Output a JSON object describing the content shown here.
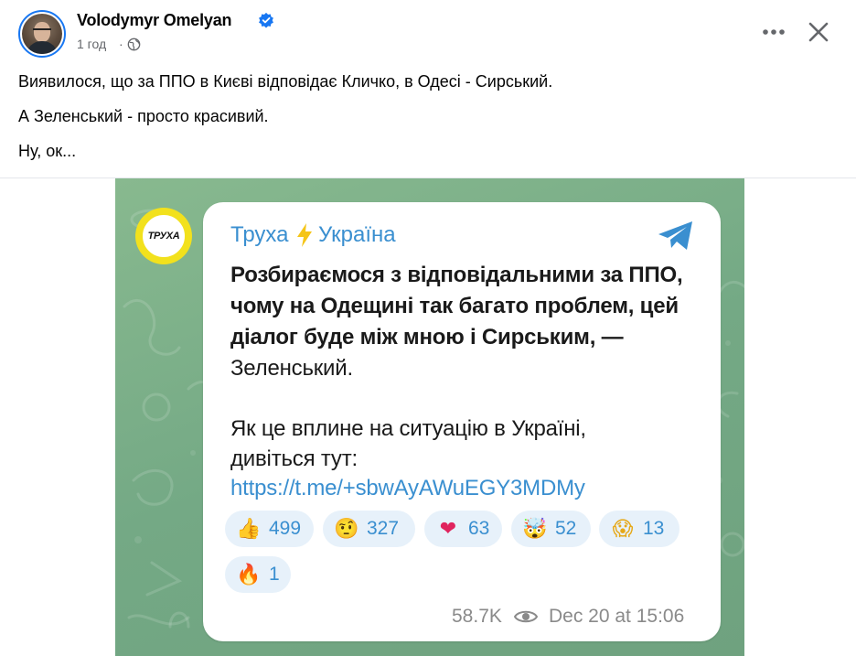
{
  "post": {
    "author": "Volodymyr Omelyan",
    "time": "1 год",
    "dot": "·",
    "lines": [
      "Виявилося, що за ППО в Києві відповідає Кличко, в Одесі - Сирський.",
      "А Зеленський - просто красивий.",
      "Ну, ок..."
    ]
  },
  "telegram": {
    "avatar_text": "ТРУХА",
    "channel_part1": "Труха",
    "channel_part2": "Україна",
    "message_bold": [
      "Розбираємося з відповідальними за ППО,",
      "чому на Одещині так багато проблем, цей",
      "діалог буде між мною і Сирським, —"
    ],
    "message_normal": [
      "Зеленський.",
      "Як це вплине на ситуацію в Україні,",
      "дивіться тут:"
    ],
    "link": "https://t.me/+sbwAyAWuEGY3MDMy",
    "reactions": [
      {
        "emoji": "👍",
        "count": "499"
      },
      {
        "emoji": "🤨",
        "count": "327"
      },
      {
        "emoji": "❤",
        "count": "63"
      },
      {
        "emoji": "🤯",
        "count": "52"
      },
      {
        "emoji": "😱",
        "count": "13"
      },
      {
        "emoji": "🔥",
        "count": "1"
      }
    ],
    "views": "58.7K",
    "date": "Dec 20 at 15:06"
  },
  "colors": {
    "facebook_blue": "#1877f2",
    "telegram_blue": "#3a8fd0",
    "bg_green": "#7fb08a"
  },
  "icons": [
    "verified-icon",
    "globe-icon",
    "more-icon",
    "close-icon",
    "bolt-icon",
    "telegram-icon",
    "eye-icon"
  ]
}
